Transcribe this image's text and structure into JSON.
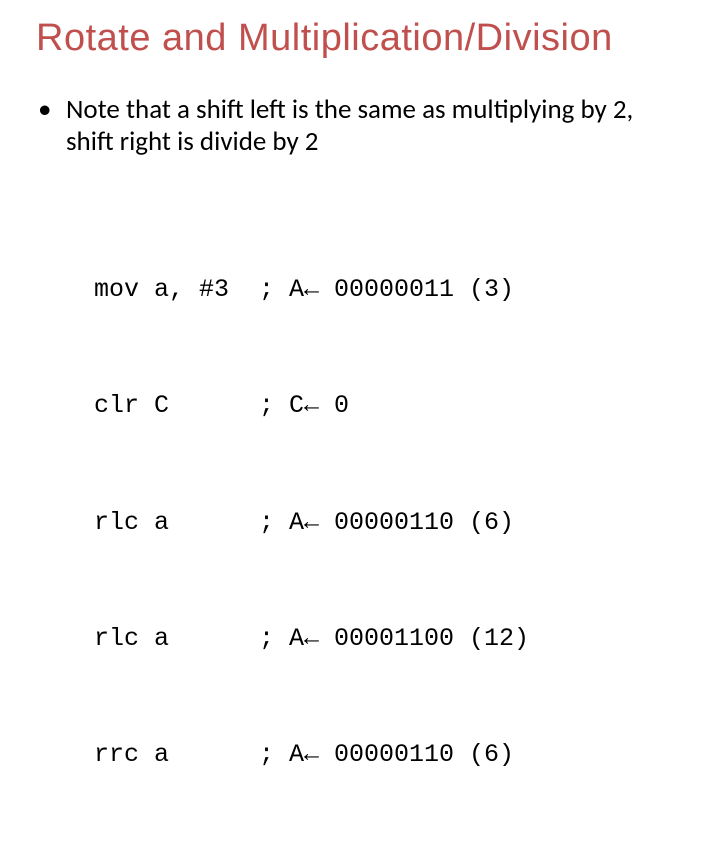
{
  "title": "Rotate and Multiplication/Division",
  "bullet": {
    "marker": "•",
    "text": "Note that a shift left is the same as multiplying by 2, shift right is divide by 2"
  },
  "code": [
    {
      "op": "mov",
      "arg": "a, #3",
      "semi": ";",
      "reg": "A",
      "arrow": "←",
      "bin": "00000011",
      "dec": "(3)"
    },
    {
      "op": "clr",
      "arg": "C",
      "semi": ";",
      "reg": "C",
      "arrow": "←",
      "bin": "0",
      "dec": ""
    },
    {
      "op": "rlc",
      "arg": "a",
      "semi": ";",
      "reg": "A",
      "arrow": "←",
      "bin": "00000110",
      "dec": "(6)"
    },
    {
      "op": "rlc",
      "arg": "a",
      "semi": ";",
      "reg": "A",
      "arrow": "←",
      "bin": "00001100",
      "dec": "(12)"
    },
    {
      "op": "rrc",
      "arg": "a",
      "semi": ";",
      "reg": "A",
      "arrow": "←",
      "bin": "00000110",
      "dec": "(6)"
    }
  ]
}
